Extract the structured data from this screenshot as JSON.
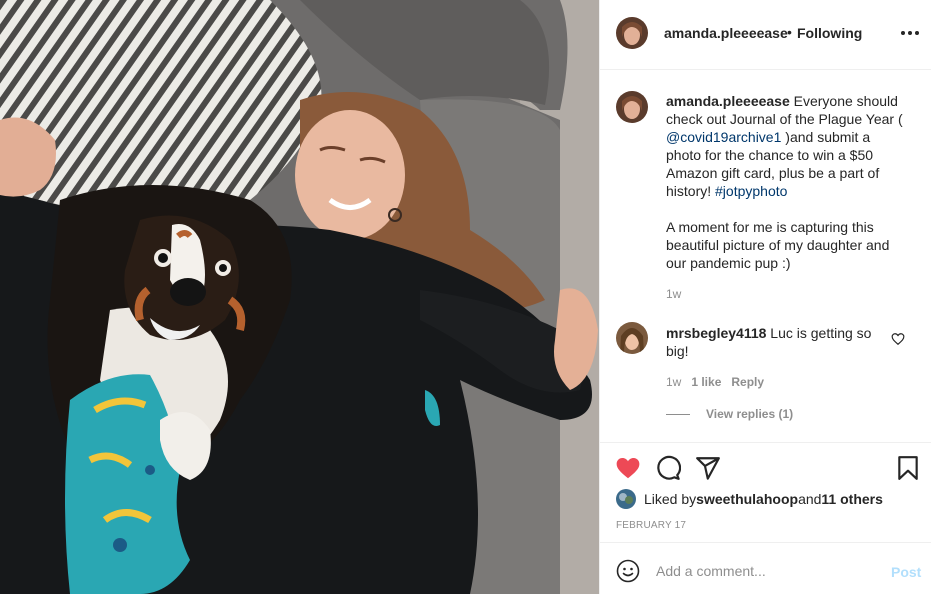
{
  "header": {
    "username": "amanda.pleeeease",
    "separator": "•",
    "follow_status": "Following",
    "more_icon": "more-options-icon"
  },
  "caption": {
    "username": "amanda.pleeeease",
    "text_1": " Everyone should check out Journal of the Plague Year (",
    "mention": "@covid19archive1",
    "text_2": " )and submit a photo for the chance to win a $50 Amazon gift card, plus be a part of history! ",
    "hashtag": "#jotpyphoto",
    "paragraph_2": "A moment for me is capturing this beautiful picture of my daughter and our pandemic pup :)",
    "time": "1w"
  },
  "comment": {
    "username": "mrsbegley4118",
    "text": " Luc is getting so big!",
    "time": "1w",
    "likes": "1 like",
    "reply": "Reply",
    "view_replies": "View replies (1)"
  },
  "actions": {
    "like_icon": "heart-filled-icon",
    "comment_icon": "comment-icon",
    "share_icon": "share-icon",
    "save_icon": "bookmark-icon",
    "like_color": "#ed4956"
  },
  "likes": {
    "prefix": "Liked by ",
    "user": "sweethulahoop",
    "middle": " and ",
    "others": "11 others"
  },
  "date": "FEBRUARY 17",
  "add_comment": {
    "placeholder": "Add a comment...",
    "post_label": "Post",
    "post_color": "#b2dffc"
  }
}
